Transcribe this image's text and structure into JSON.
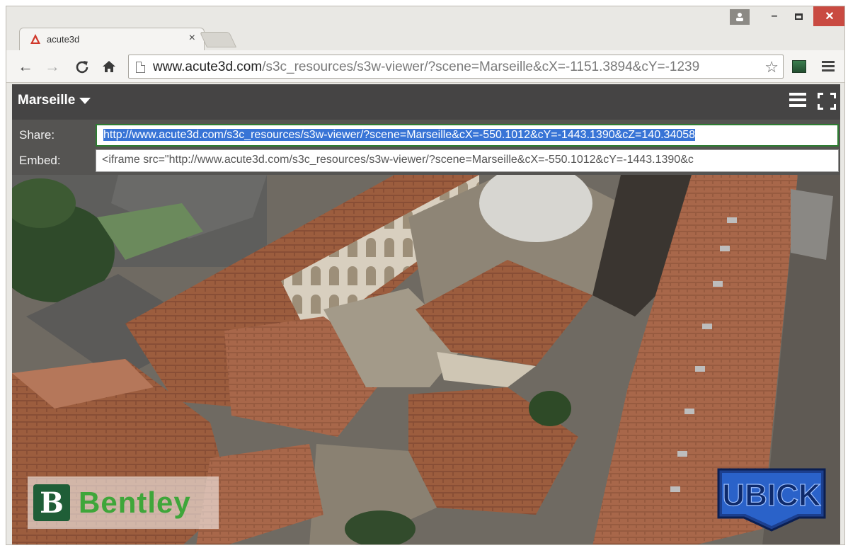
{
  "browser": {
    "tab": {
      "title": "acute3d"
    },
    "address_bar": {
      "host": "www.acute3d.com",
      "path": "/s3c_resources/s3w-viewer/?scene=Marseille&cX=-1151.3894&cY=-1239"
    }
  },
  "viewer": {
    "scene_name": "Marseille",
    "share": {
      "label": "Share:",
      "value": "http://www.acute3d.com/s3c_resources/s3w-viewer/?scene=Marseille&cX=-550.1012&cY=-1443.1390&cZ=140.34058"
    },
    "embed": {
      "label": "Embed:",
      "value": "<iframe src=\"http://www.acute3d.com/s3c_resources/s3w-viewer/?scene=Marseille&cX=-550.1012&cY=-1443.1390&c"
    },
    "logos": {
      "bentley_mark": "B",
      "bentley": "Bentley",
      "ubick": "UBICK"
    }
  },
  "icons": {
    "back": "back-arrow-icon",
    "forward": "forward-arrow-icon",
    "reload": "reload-icon",
    "home": "home-icon",
    "star": "star-icon",
    "menu": "menu-icon",
    "fullscreen": "fullscreen-icon"
  },
  "colors": {
    "viewer_bar": "#454444",
    "share_highlight": "#3874d6",
    "window_close": "#c94a41",
    "bentley_green": "#3fa63a",
    "ubick_blue": "#2a62c9"
  }
}
